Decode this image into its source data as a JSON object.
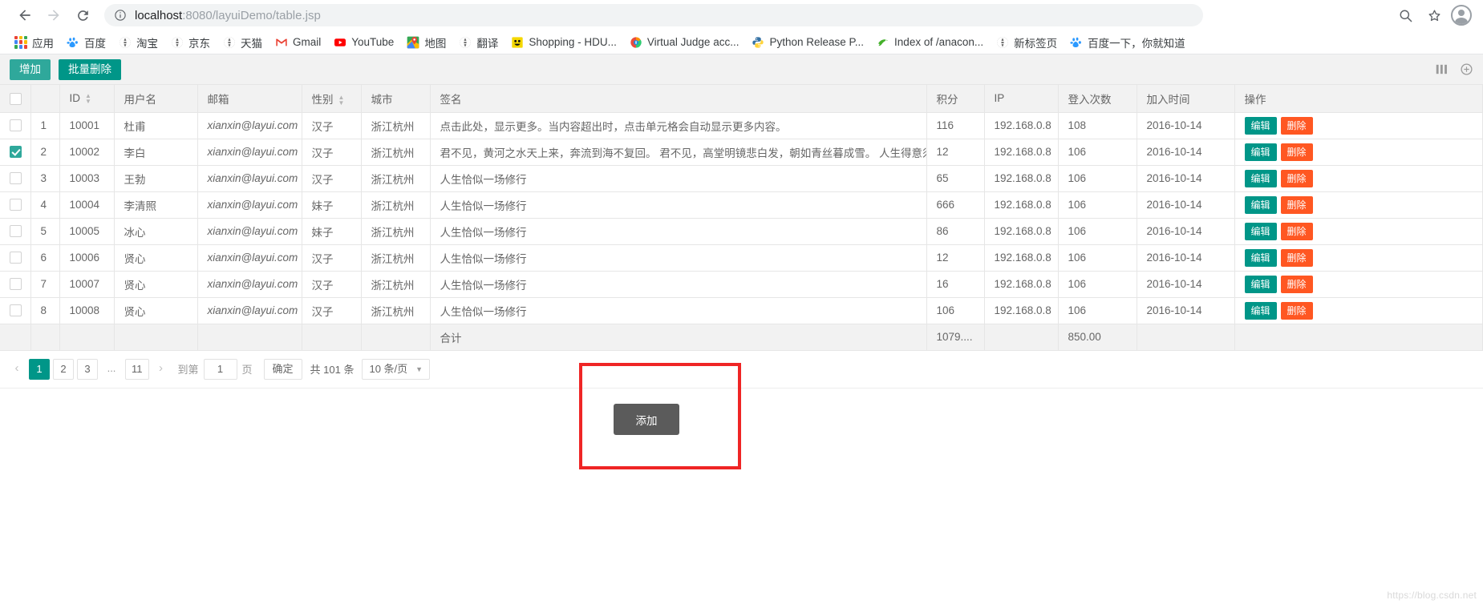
{
  "browser": {
    "back_icon": "arrow-left-icon",
    "forward_icon": "arrow-right-icon",
    "reload_icon": "reload-icon",
    "site_info_icon": "info-circle-icon",
    "url_prefix": "localhost",
    "url_rest": ":8080/layuiDemo/table.jsp",
    "url_full": "localhost:8080/layuiDemo/table.jsp",
    "zoom_icon": "zoom-search-icon",
    "bookmark_icon": "star-icon",
    "profile_icon": "avatar-icon"
  },
  "bookmarks": [
    {
      "label": "应用",
      "icon": "apps-grid-icon"
    },
    {
      "label": "百度",
      "icon": "baidu-paw-icon"
    },
    {
      "label": "淘宝",
      "icon": "globe-icon"
    },
    {
      "label": "京东",
      "icon": "globe-icon"
    },
    {
      "label": "天猫",
      "icon": "globe-icon"
    },
    {
      "label": "Gmail",
      "icon": "gmail-icon"
    },
    {
      "label": "YouTube",
      "icon": "youtube-icon"
    },
    {
      "label": "地图",
      "icon": "google-maps-icon"
    },
    {
      "label": "翻译",
      "icon": "globe-icon"
    },
    {
      "label": "Shopping - HDU...",
      "icon": "smiley-icon"
    },
    {
      "label": "Virtual Judge acc...",
      "icon": "vjudge-icon"
    },
    {
      "label": "Python Release P...",
      "icon": "python-icon"
    },
    {
      "label": "Index of /anacon...",
      "icon": "anaconda-icon"
    },
    {
      "label": "新标签页",
      "icon": "globe-icon"
    },
    {
      "label": "百度一下，你就知道",
      "icon": "baidu-paw-icon"
    }
  ],
  "toolbar": {
    "add_label": "增加",
    "batch_delete_label": "批量删除",
    "add_color": "#2fa89b",
    "batch_delete_color": "#009688",
    "column_filter_icon": "columns-icon",
    "export_icon": "export-icon"
  },
  "table": {
    "columns": [
      {
        "key": "checkbox",
        "label": "",
        "sortable": false
      },
      {
        "key": "num",
        "label": "",
        "sortable": false
      },
      {
        "key": "id",
        "label": "ID",
        "sortable": true
      },
      {
        "key": "user",
        "label": "用户名",
        "sortable": false
      },
      {
        "key": "mail",
        "label": "邮箱",
        "sortable": false
      },
      {
        "key": "sex",
        "label": "性别",
        "sortable": true
      },
      {
        "key": "city",
        "label": "城市",
        "sortable": false
      },
      {
        "key": "sign",
        "label": "签名",
        "sortable": false
      },
      {
        "key": "score",
        "label": "积分",
        "sortable": false
      },
      {
        "key": "ip",
        "label": "IP",
        "sortable": false
      },
      {
        "key": "login",
        "label": "登入次数",
        "sortable": false
      },
      {
        "key": "join",
        "label": "加入时间",
        "sortable": false
      },
      {
        "key": "op",
        "label": "操作",
        "sortable": false
      }
    ],
    "rows": [
      {
        "checked": false,
        "num": "1",
        "id": "10001",
        "user": "杜甫",
        "mail": "xianxin@layui.com",
        "sex": "汉子",
        "city": "浙江杭州",
        "sign": "点击此处，显示更多。当内容超出时，点击单元格会自动显示更多内容。",
        "score": "116",
        "ip": "192.168.0.8",
        "login": "108",
        "join": "2016-10-14"
      },
      {
        "checked": true,
        "num": "2",
        "id": "10002",
        "user": "李白",
        "mail": "xianxin@layui.com",
        "sex": "汉子",
        "city": "浙江杭州",
        "sign": "君不见，黄河之水天上来，奔流到海不复回。 君不见，高堂明镜悲白发，朝如青丝暮成雪。 人生得意须尽欢，",
        "score": "12",
        "ip": "192.168.0.8",
        "login": "106",
        "join": "2016-10-14"
      },
      {
        "checked": false,
        "num": "3",
        "id": "10003",
        "user": "王勃",
        "mail": "xianxin@layui.com",
        "sex": "汉子",
        "city": "浙江杭州",
        "sign": "人生恰似一场修行",
        "score": "65",
        "ip": "192.168.0.8",
        "login": "106",
        "join": "2016-10-14"
      },
      {
        "checked": false,
        "num": "4",
        "id": "10004",
        "user": "李清照",
        "mail": "xianxin@layui.com",
        "sex": "妹子",
        "city": "浙江杭州",
        "sign": "人生恰似一场修行",
        "score": "666",
        "ip": "192.168.0.8",
        "login": "106",
        "join": "2016-10-14"
      },
      {
        "checked": false,
        "num": "5",
        "id": "10005",
        "user": "冰心",
        "mail": "xianxin@layui.com",
        "sex": "妹子",
        "city": "浙江杭州",
        "sign": "人生恰似一场修行",
        "score": "86",
        "ip": "192.168.0.8",
        "login": "106",
        "join": "2016-10-14"
      },
      {
        "checked": false,
        "num": "6",
        "id": "10006",
        "user": "贤心",
        "mail": "xianxin@layui.com",
        "sex": "汉子",
        "city": "浙江杭州",
        "sign": "人生恰似一场修行",
        "score": "12",
        "ip": "192.168.0.8",
        "login": "106",
        "join": "2016-10-14"
      },
      {
        "checked": false,
        "num": "7",
        "id": "10007",
        "user": "贤心",
        "mail": "xianxin@layui.com",
        "sex": "汉子",
        "city": "浙江杭州",
        "sign": "人生恰似一场修行",
        "score": "16",
        "ip": "192.168.0.8",
        "login": "106",
        "join": "2016-10-14"
      },
      {
        "checked": false,
        "num": "8",
        "id": "10008",
        "user": "贤心",
        "mail": "xianxin@layui.com",
        "sex": "汉子",
        "city": "浙江杭州",
        "sign": "人生恰似一场修行",
        "score": "106",
        "ip": "192.168.0.8",
        "login": "106",
        "join": "2016-10-14"
      }
    ],
    "summary": {
      "sign": "合计",
      "score": "1079....",
      "login": "850.00"
    },
    "row_action": {
      "edit_label": "编辑",
      "delete_label": "删除",
      "edit_color": "#009688",
      "delete_color": "#ff5722"
    }
  },
  "pagination": {
    "prev_icon": "chevron-left-icon",
    "next_icon": "chevron-right-icon",
    "pages": [
      "1",
      "2",
      "3",
      "...",
      "11"
    ],
    "current_page": "1",
    "goto_label": "到第",
    "goto_value": "1",
    "page_unit": "页",
    "confirm_label": "确定",
    "total_label": "共 101 条",
    "limit_label": "10 条/页",
    "caret_icon": "caret-down-icon"
  },
  "annotation": {
    "popup_label": "添加",
    "rect_color": "#ef2525",
    "popup_bg": "#5b5b5b"
  },
  "watermark": "https://blog.csdn.net"
}
